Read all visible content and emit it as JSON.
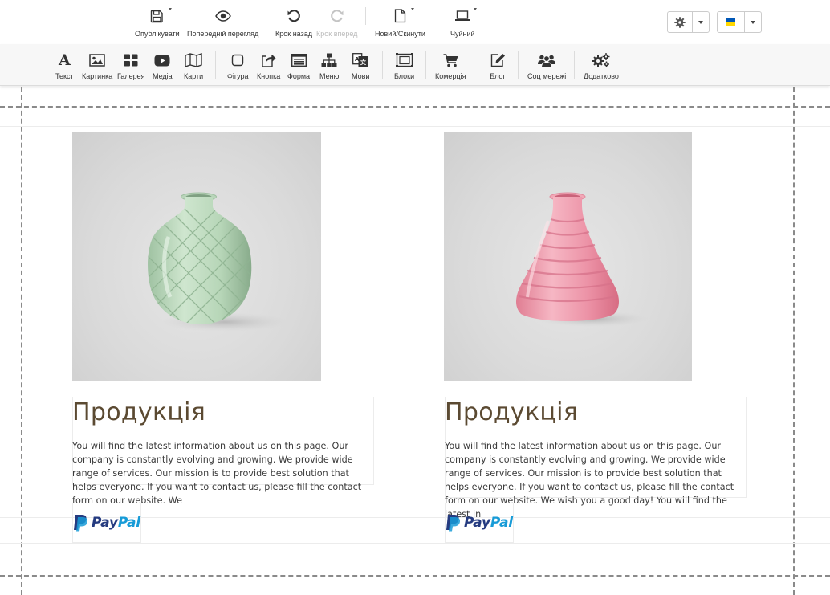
{
  "top_toolbar": {
    "publish_label": "Опублікувати",
    "preview_label": "Попередній перегляд",
    "undo_label": "Крок назад",
    "redo_label": "Крок вперед",
    "new_reset_label": "Новий/Скинути",
    "device_label": "Чуйний",
    "language_flag_colors": [
      "#0057b7",
      "#ffd700"
    ]
  },
  "widget_toolbar": {
    "items": [
      {
        "label": "Текст",
        "icon": "text-icon"
      },
      {
        "label": "Картинка",
        "icon": "image-icon"
      },
      {
        "label": "Галерея",
        "icon": "gallery-icon"
      },
      {
        "label": "Медіа",
        "icon": "media-icon"
      },
      {
        "label": "Карти",
        "icon": "map-icon"
      },
      {
        "label": "Фігура",
        "icon": "shape-icon"
      },
      {
        "label": "Кнопка",
        "icon": "button-icon"
      },
      {
        "label": "Форма",
        "icon": "form-icon"
      },
      {
        "label": "Меню",
        "icon": "menu-icon"
      },
      {
        "label": "Мови",
        "icon": "languages-icon"
      },
      {
        "label": "Блоки",
        "icon": "blocks-icon"
      },
      {
        "label": "Комерція",
        "icon": "cart-icon"
      },
      {
        "label": "Блог",
        "icon": "blog-icon"
      },
      {
        "label": "Соц мережі",
        "icon": "social-icon"
      },
      {
        "label": "Додатково",
        "icon": "extra-icon"
      }
    ]
  },
  "products": [
    {
      "title": "Продукція",
      "description": "You will find the latest information about us on this page. Our company is constantly evolving and growing. We provide wide range of services. Our mission is to provide best solution that helps everyone. If you want to contact us, please fill the contact form on our website. We",
      "image": "green-vase-image",
      "button": "paypal-button"
    },
    {
      "title": "Продукція",
      "description": "You will find the latest information about us on this page. Our company is constantly evolving and growing. We provide wide range of services. Our mission is to provide best solution that helps everyone. If you want to contact us, please fill the contact form on our website. We wish you a good day! You will find the latest in",
      "image": "pink-vase-image",
      "button": "paypal-button"
    }
  ],
  "paypal": {
    "pay": "Pay",
    "pal": "Pal"
  },
  "colors": {
    "accent_brown": "#5b4a32",
    "paypal_dark": "#253b80",
    "paypal_light": "#179bd7",
    "vase_green": "#bcd9bd",
    "vase_pink": "#e98a9e"
  }
}
